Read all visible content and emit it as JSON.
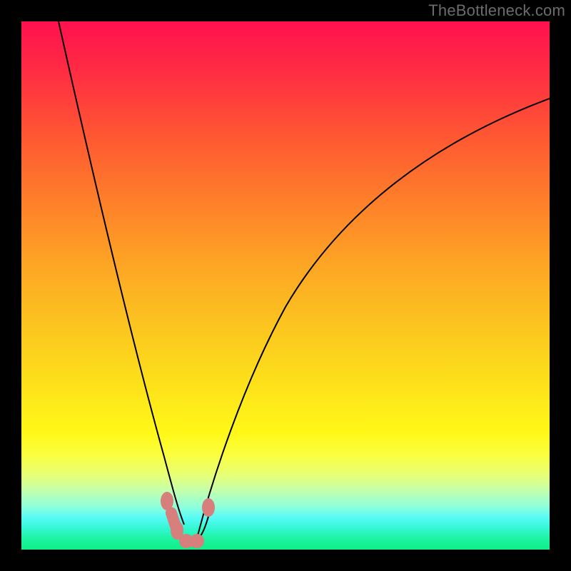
{
  "watermark": "TheBottleneck.com",
  "chart_data": {
    "type": "line",
    "title": "",
    "xlabel": "",
    "ylabel": "",
    "xlim": [
      0,
      100
    ],
    "ylim": [
      0,
      100
    ],
    "grid": false,
    "legend": false,
    "series": [
      {
        "name": "bottleneck-curve",
        "x": [
          7,
          10,
          14,
          18,
          22,
          25,
          27,
          29,
          30,
          31,
          32,
          33,
          35,
          38,
          42,
          48,
          55,
          62,
          70,
          80,
          90,
          100
        ],
        "y": [
          100,
          86,
          70,
          54,
          38,
          24,
          14,
          7,
          3,
          1,
          1,
          3,
          7,
          16,
          28,
          42,
          54,
          63,
          71,
          78,
          83,
          86
        ]
      }
    ],
    "markers": [
      {
        "name": "left-end",
        "x": 27.5,
        "y": 9
      },
      {
        "name": "bottom-1",
        "x": 29.5,
        "y": 3.5
      },
      {
        "name": "bottom-2",
        "x": 31,
        "y": 1.5
      },
      {
        "name": "bottom-3",
        "x": 33,
        "y": 1.5
      },
      {
        "name": "right-end",
        "x": 35,
        "y": 8
      }
    ],
    "gradient_bands": [
      {
        "stop": 0.0,
        "color": "#ff114e"
      },
      {
        "stop": 0.22,
        "color": "#ff5832"
      },
      {
        "stop": 0.46,
        "color": "#fda524"
      },
      {
        "stop": 0.7,
        "color": "#fde41a"
      },
      {
        "stop": 0.86,
        "color": "#e6ff78"
      },
      {
        "stop": 0.94,
        "color": "#56fbf6"
      },
      {
        "stop": 1.0,
        "color": "#0fef87"
      }
    ]
  }
}
